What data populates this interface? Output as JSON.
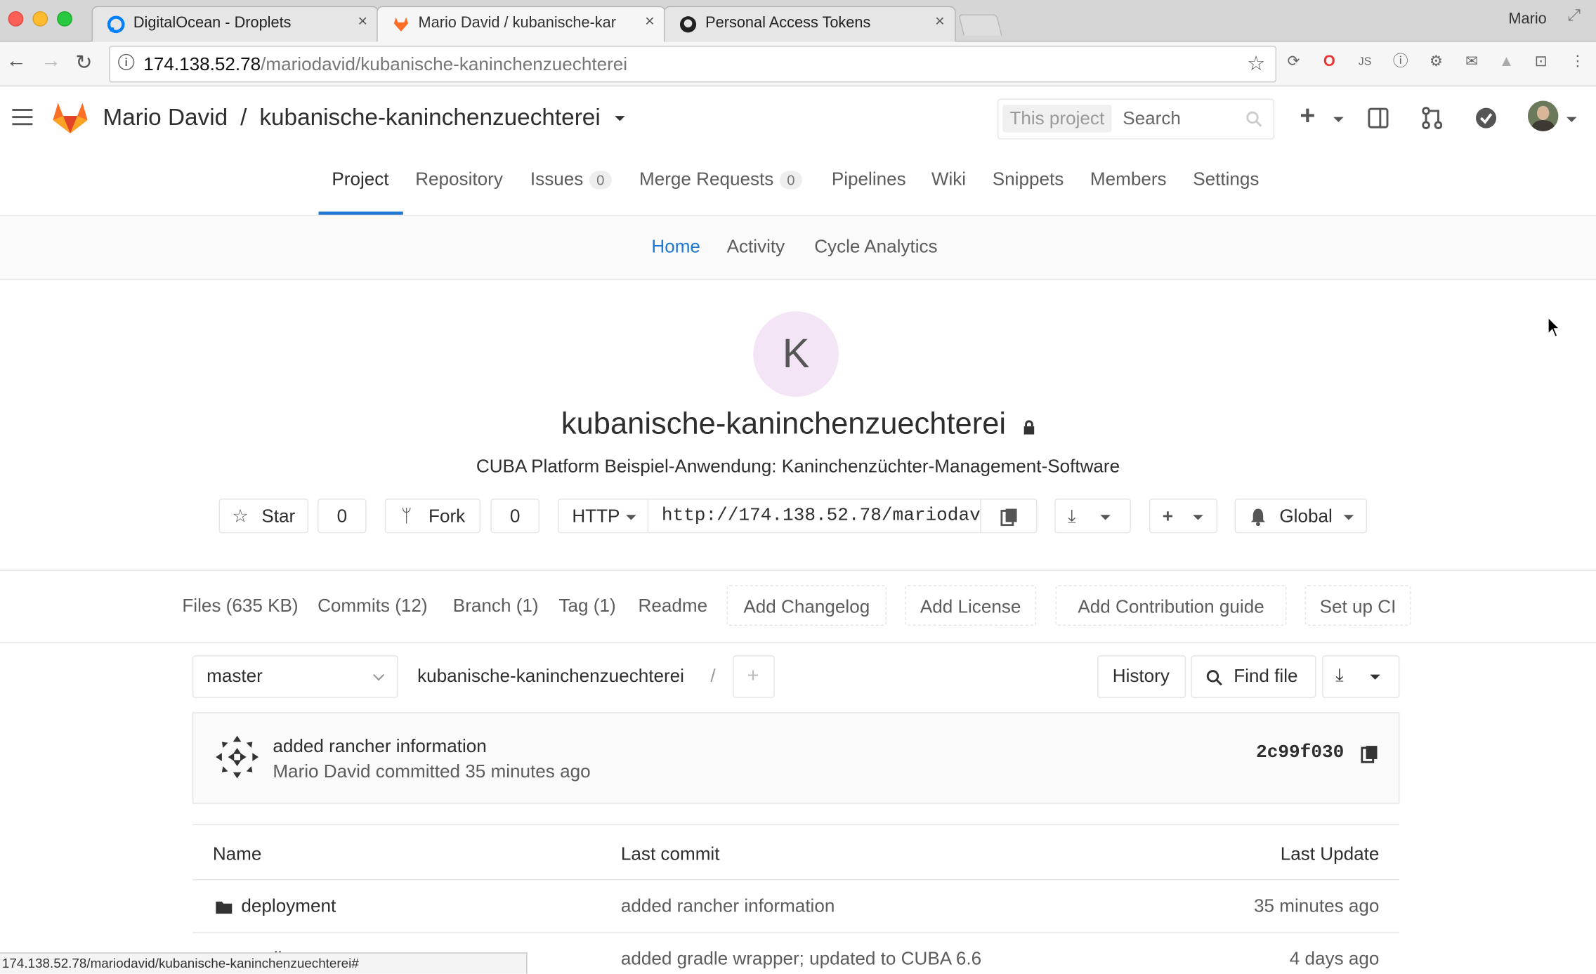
{
  "browser": {
    "tabs": [
      {
        "title": "DigitalOcean - Droplets"
      },
      {
        "title": "Mario David / kubanische-kar"
      },
      {
        "title": "Personal Access Tokens"
      }
    ],
    "profile_name": "Mario",
    "url_host": "174.138.52.78",
    "url_path": "/mariodavid/kubanische-kaninchenzuechterei",
    "status_url": "174.138.52.78/mariodavid/kubanische-kaninchenzuechterei#"
  },
  "header": {
    "owner": "Mario David",
    "separator": "/",
    "project": "kubanische-kaninchenzuechterei",
    "search_scope": "This project",
    "search_placeholder": "Search"
  },
  "nav": {
    "tabs": [
      {
        "label": "Project"
      },
      {
        "label": "Repository"
      },
      {
        "label": "Issues",
        "count": "0"
      },
      {
        "label": "Merge Requests",
        "count": "0"
      },
      {
        "label": "Pipelines"
      },
      {
        "label": "Wiki"
      },
      {
        "label": "Snippets"
      },
      {
        "label": "Members"
      },
      {
        "label": "Settings"
      }
    ],
    "subtabs": [
      "Home",
      "Activity",
      "Cycle Analytics"
    ]
  },
  "project": {
    "avatar_letter": "K",
    "name": "kubanische-kaninchenzuechterei",
    "description": "CUBA Platform Beispiel-Anwendung: Kaninchenzüchter-Management-Software",
    "star_label": "Star",
    "star_count": "0",
    "fork_label": "Fork",
    "fork_count": "0",
    "protocol": "HTTP",
    "clone_url": "http://174.138.52.78/mariodav",
    "notification": "Global"
  },
  "stats": [
    "Files (635 KB)",
    "Commits (12)",
    "Branch (1)",
    "Tag (1)",
    "Readme"
  ],
  "stat_buttons": [
    "Add Changelog",
    "Add License",
    "Add Contribution guide",
    "Set up CI"
  ],
  "repo": {
    "branch": "master",
    "path": "kubanische-kaninchenzuechterei",
    "path_sep": "/",
    "history_label": "History",
    "find_file_label": "Find file"
  },
  "last_commit": {
    "message": "added rancher information",
    "meta": "Mario David committed 35 minutes ago",
    "sha": "2c99f030"
  },
  "files_table": {
    "headers": [
      "Name",
      "Last commit",
      "Last Update"
    ],
    "rows": [
      {
        "name": "deployment",
        "commit": "added rancher information",
        "updated": "35 minutes ago"
      },
      {
        "name": "gradle",
        "commit": "added gradle wrapper; updated to CUBA 6.6",
        "updated": "4 days ago"
      }
    ]
  },
  "colors": {
    "accent": "#1f78d1",
    "active_tab_border": "#1f78d1",
    "avatar_bg": "#f3e5f5",
    "gitlab_orange": "#fc6d26"
  }
}
